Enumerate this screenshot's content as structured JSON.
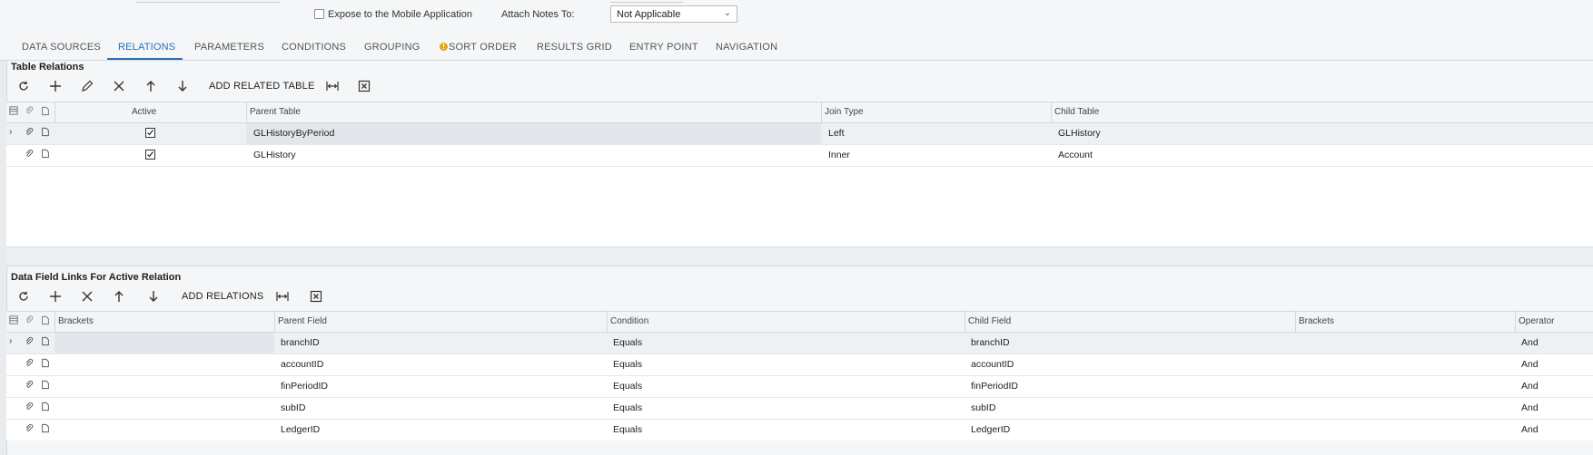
{
  "form": {
    "expose_mobile_label": "Expose to the Mobile Application",
    "attach_notes_label": "Attach Notes To:",
    "attach_notes_value": "Not Applicable"
  },
  "tabs": [
    {
      "label": "DATA SOURCES"
    },
    {
      "label": "RELATIONS",
      "active": true
    },
    {
      "label": "PARAMETERS"
    },
    {
      "label": "CONDITIONS"
    },
    {
      "label": "GROUPING"
    },
    {
      "label": "SORT ORDER",
      "warning": true
    },
    {
      "label": "RESULTS GRID"
    },
    {
      "label": "ENTRY POINT"
    },
    {
      "label": "NAVIGATION"
    }
  ],
  "table_relations": {
    "title": "Table Relations",
    "toolbar": {
      "refresh_icon": "refresh-icon",
      "add_icon": "plus-icon",
      "edit_icon": "pencil-icon",
      "delete_icon": "close-icon",
      "up_icon": "arrow-up-icon",
      "down_icon": "arrow-down-icon",
      "add_related_label": "ADD RELATED TABLE",
      "fit_icon": "fit-columns-icon",
      "excel_icon": "excel-export-icon"
    },
    "columns": [
      "Active",
      "Parent Table",
      "Join Type",
      "Child Table"
    ],
    "rows": [
      {
        "active": true,
        "parent": "GLHistoryByPeriod",
        "join": "Left",
        "child": "GLHistory"
      },
      {
        "active": true,
        "parent": "GLHistory",
        "join": "Inner",
        "child": "Account"
      }
    ]
  },
  "field_links": {
    "title": "Data Field Links For Active Relation",
    "toolbar": {
      "add_relations_label": "ADD RELATIONS"
    },
    "columns": [
      "Brackets",
      "Parent Field",
      "Condition",
      "Child Field",
      "Brackets",
      "Operator"
    ],
    "rows": [
      {
        "brackets": "",
        "parent": "branchID",
        "condition": "Equals",
        "child": "branchID",
        "brackets2": "",
        "operator": "And"
      },
      {
        "brackets": "",
        "parent": "accountID",
        "condition": "Equals",
        "child": "accountID",
        "brackets2": "",
        "operator": "And"
      },
      {
        "brackets": "",
        "parent": "finPeriodID",
        "condition": "Equals",
        "child": "finPeriodID",
        "brackets2": "",
        "operator": "And"
      },
      {
        "brackets": "",
        "parent": "subID",
        "condition": "Equals",
        "child": "subID",
        "brackets2": "",
        "operator": "And"
      },
      {
        "brackets": "",
        "parent": "LedgerID",
        "condition": "Equals",
        "child": "LedgerID",
        "brackets2": "",
        "operator": "And"
      }
    ]
  },
  "colors": {
    "accent": "#2a6fb5",
    "warning": "#e8a317"
  }
}
